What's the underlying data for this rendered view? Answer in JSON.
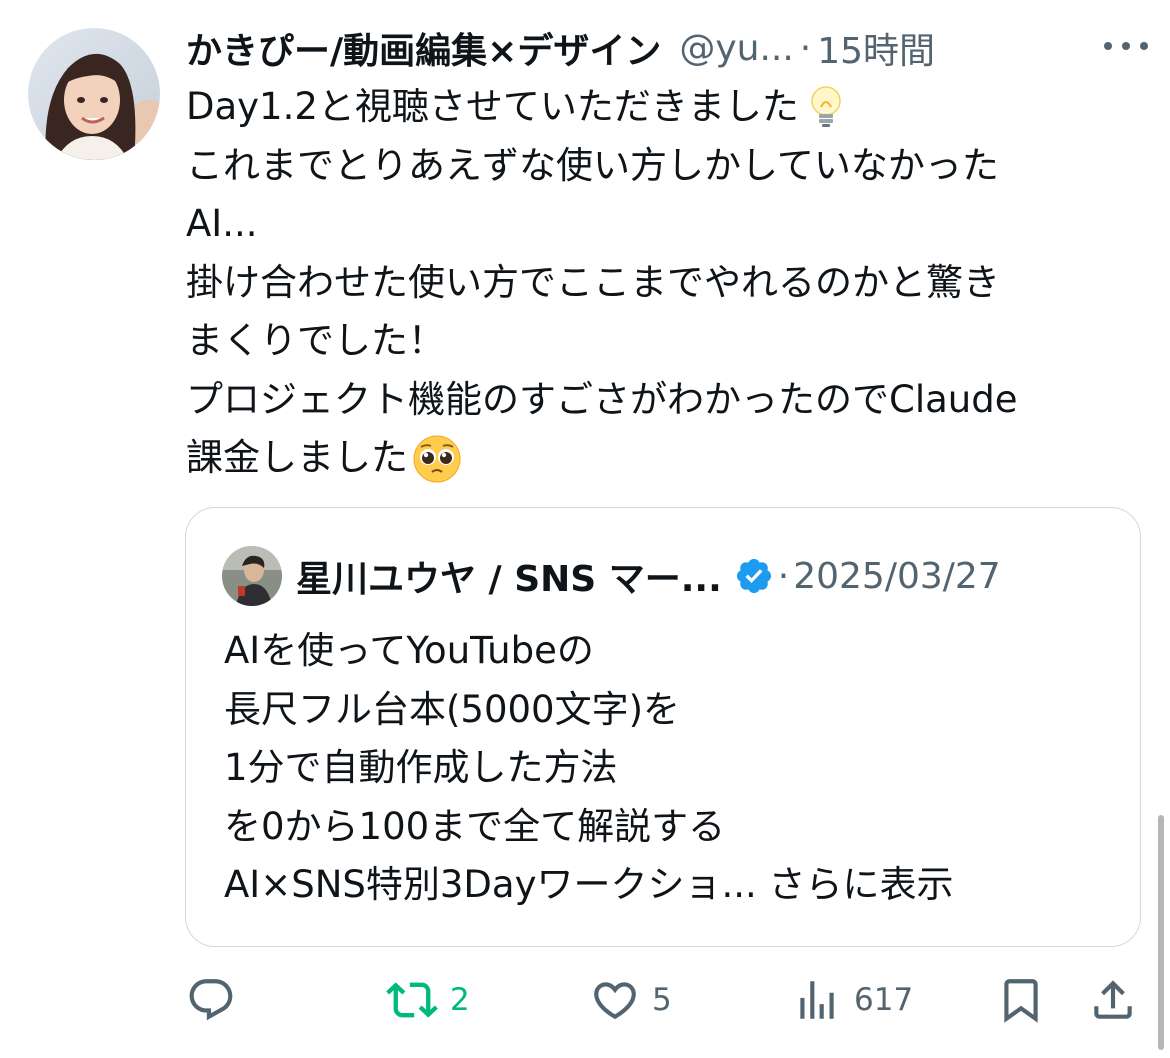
{
  "tweet": {
    "display_name": "かきぴー/動画編集×デザイン",
    "handle": "@yu...",
    "separator": "·",
    "timestamp": "15時間",
    "lines": [
      "Day1.2と視聴させていただきました",
      "これまでとりあえずな使い方しかしていなかった",
      "AI...",
      "掛け合わせた使い方でここまでやれるのかと驚き",
      "まくりでした！",
      "プロジェクト機能のすごさがわかったのでClaude",
      "課金しました"
    ],
    "emojis": [
      "lightbulb-emoji",
      "pleading-face-emoji"
    ]
  },
  "quote": {
    "display_name": "星川ユウヤ / SNS マー...",
    "separator": "·",
    "date": "2025/03/27",
    "verified": true,
    "lines": [
      "AIを使ってYouTubeの",
      "長尺フル台本(5000文字)を",
      "1分で自動作成した方法",
      "を0から100まで全て解説する",
      "AI×SNS特別3Dayワークショ... さらに表示"
    ]
  },
  "actions": {
    "reply_count": "",
    "retweet_count": "2",
    "like_count": "5",
    "views_count": "617"
  },
  "colors": {
    "text": "#0f1419",
    "secondary": "#536471",
    "retweet_active": "#00ba7c",
    "verified": "#1d9bf0",
    "border": "#cfd9de"
  }
}
